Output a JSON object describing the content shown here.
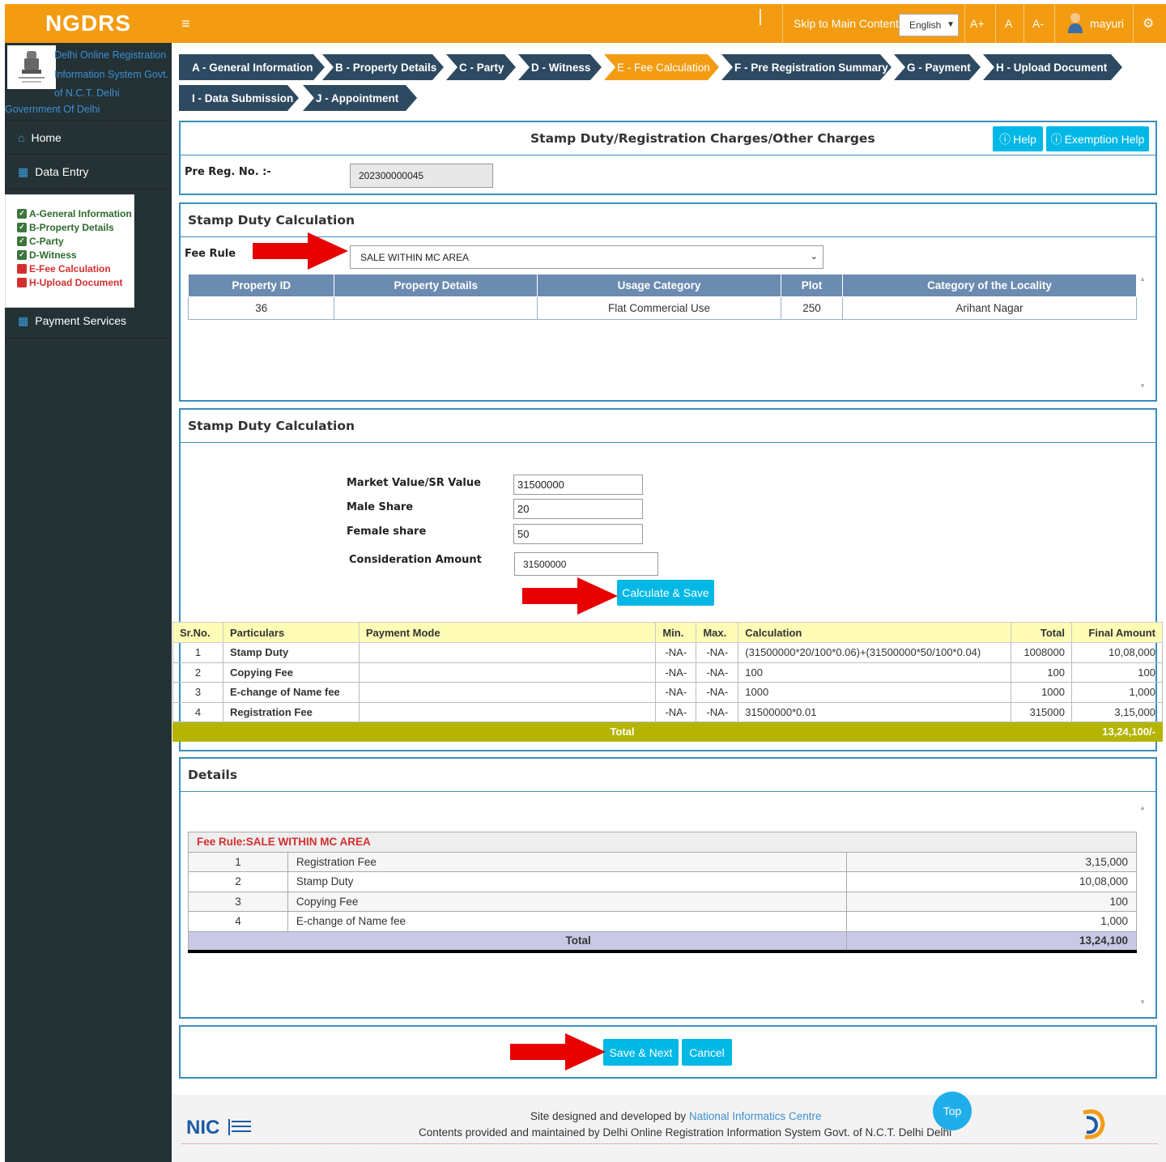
{
  "app": {
    "logo": "NGDRS",
    "org_name": "Delhi Online Registration Information System Govt. of N.C.T. Delhi",
    "org_sub": "Government Of Delhi"
  },
  "topbar": {
    "menu_icon": "hamburger-icon",
    "skip": "Skip to Main Content",
    "language": "English",
    "font_increase": "A+",
    "font_normal": "A",
    "font_decrease": "A-",
    "user": "mayuri",
    "settings_icon": "gear-icon"
  },
  "sidebar": {
    "home": "Home",
    "data_entry": "Data Entry",
    "payment": "Payment Services",
    "data_entry_items": [
      {
        "label": "A-General Information",
        "status": "done"
      },
      {
        "label": "B-Property Details",
        "status": "done"
      },
      {
        "label": "C-Party",
        "status": "done"
      },
      {
        "label": "D-Witness",
        "status": "done"
      },
      {
        "label": "E-Fee Calculation",
        "status": "pending"
      },
      {
        "label": "H-Upload Document",
        "status": "pending"
      }
    ]
  },
  "tabs": [
    "A - General Information",
    "B - Property Details",
    "C - Party",
    "D - Witness",
    "E - Fee Calculation",
    "F - Pre Registration Summary",
    "G - Payment",
    "H - Upload Document",
    "I - Data Submission",
    "J - Appointment"
  ],
  "active_tab": "E - Fee Calculation",
  "header_panel": {
    "title": "Stamp Duty/Registration Charges/Other Charges",
    "help": "Help",
    "exemption_help": "Exemption Help",
    "pre_reg_label": "Pre Reg. No. :-",
    "pre_reg_value": "202300000045"
  },
  "fee_rule_panel": {
    "title": "Stamp Duty Calculation",
    "fee_rule_label": "Fee Rule",
    "fee_rule_value": "SALE WITHIN MC AREA",
    "columns": [
      "Property ID",
      "Property Details",
      "Usage Category",
      "Plot",
      "Category of the Locality"
    ],
    "rows": [
      [
        "36",
        "",
        "Flat Commercial Use",
        "250",
        "Arihant Nagar"
      ]
    ]
  },
  "calc_panel": {
    "title": "Stamp Duty Calculation",
    "market_value_label": "Market Value/SR Value",
    "market_value": "31500000",
    "male_share_label": "Male Share",
    "male_share": "20",
    "female_share_label": "Female share",
    "female_share": "50",
    "consideration_label": "Consideration Amount",
    "consideration": "31500000",
    "calculate_btn": "Calculate & Save"
  },
  "fee_table": {
    "columns": [
      "Sr.No.",
      "Particulars",
      "Payment Mode",
      "Min.",
      "Max.",
      "Calculation",
      "Total",
      "Final Amount"
    ],
    "rows": [
      [
        "1",
        "Stamp Duty",
        "",
        "-NA-",
        "-NA-",
        "(31500000*20/100*0.06)+(31500000*50/100*0.04)",
        "1008000",
        "10,08,000"
      ],
      [
        "2",
        "Copying Fee",
        "",
        "-NA-",
        "-NA-",
        "100",
        "100",
        "100"
      ],
      [
        "3",
        "E-change of Name fee",
        "",
        "-NA-",
        "-NA-",
        "1000",
        "1000",
        "1,000"
      ],
      [
        "4",
        "Registration Fee",
        "",
        "-NA-",
        "-NA-",
        "31500000*0.01",
        "315000",
        "3,15,000"
      ]
    ],
    "total_label": "Total",
    "total_value": "13,24,100/-"
  },
  "details_panel": {
    "title": "Details",
    "rule_label": "Fee Rule:SALE WITHIN MC AREA",
    "rows": [
      [
        "1",
        "Registration Fee",
        "3,15,000"
      ],
      [
        "2",
        "Stamp Duty",
        "10,08,000"
      ],
      [
        "3",
        "Copying Fee",
        "100"
      ],
      [
        "4",
        "E-change of Name fee",
        "1,000"
      ]
    ],
    "total_label": "Total",
    "total_value": "13,24,100"
  },
  "actions": {
    "save_next": "Save & Next",
    "cancel": "Cancel"
  },
  "footer": {
    "line1_prefix": "Site designed and developed by",
    "line1_link": "National Informatics Centre",
    "line2": "Contents provided and maintained by Delhi Online Registration Information System Govt. of N.C.T. Delhi Delhi",
    "top_btn": "Top",
    "nic_logo_text": "NIC"
  },
  "colors": {
    "brand_orange": "#f39c12",
    "tab_blue": "#2e4a62",
    "accent_cyan": "#00b8e6",
    "sidebar_dark": "#243135",
    "arrow_red": "#e60000"
  }
}
